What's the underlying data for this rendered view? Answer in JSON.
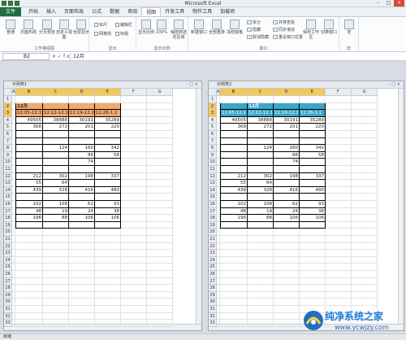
{
  "app": {
    "title": "Microsoft Excel"
  },
  "ribbon_tabs": [
    "文件",
    "开始",
    "插入",
    "页面布局",
    "公式",
    "数据",
    "审阅",
    "视图",
    "开发工具",
    "制作工具",
    "加载项"
  ],
  "active_tab": "视图",
  "ribbon": {
    "groups": [
      "工作簿视图",
      "显示",
      "显示比例",
      "窗口",
      "宏"
    ],
    "view_buttons": [
      "普通",
      "页面布局",
      "分页预览",
      "自定义视图",
      "全屏显示"
    ],
    "show_checks": [
      "标尺",
      "编辑栏",
      "网格线",
      "标题"
    ],
    "zoom_buttons": [
      "显示比例",
      "100%",
      "缩放到选定区域"
    ],
    "window_buttons": [
      "新建窗口",
      "全部重排",
      "冻结窗格"
    ],
    "window_small": [
      "拆分",
      "隐藏",
      "取消隐藏",
      "并排查看",
      "同步滚动",
      "重设窗口位置"
    ],
    "window_more": [
      "保存工作区",
      "切换窗口"
    ],
    "macro_button": "宏"
  },
  "formula_bar": {
    "name_box": "B2",
    "value": "12月"
  },
  "window1": {
    "title": "示例表1"
  },
  "window2": {
    "title": "示例表2"
  },
  "status": "就绪",
  "sheet": {
    "title": "12月",
    "dates": [
      "12.05-12.11",
      "12.12-12.18",
      "12.19-12.25",
      "12.26-1.1"
    ],
    "rows": [
      {
        "r": 4,
        "v": [
          "49505",
          "38888",
          "30191",
          "35289"
        ]
      },
      {
        "r": 5,
        "v": [
          "368",
          "272",
          "201",
          "220"
        ]
      },
      {
        "r": 8,
        "v": [
          "",
          "124",
          "160",
          "342"
        ]
      },
      {
        "r": 9,
        "v": [
          "",
          "",
          "86",
          "58"
        ]
      },
      {
        "r": 10,
        "v": [
          "",
          "",
          "74",
          ""
        ]
      },
      {
        "r": 12,
        "v": [
          "212",
          "302",
          "198",
          "337"
        ]
      },
      {
        "r": 13,
        "v": [
          "55",
          "64",
          "",
          ""
        ]
      },
      {
        "r": 14,
        "v": [
          "439",
          "328",
          "416",
          "480"
        ]
      },
      {
        "r": 16,
        "v": [
          "102",
          "108",
          "62",
          "93"
        ]
      },
      {
        "r": 17,
        "v": [
          "48",
          "19",
          "24",
          "38"
        ]
      },
      {
        "r": 18,
        "v": [
          "196",
          "88",
          "106",
          "106"
        ]
      }
    ]
  },
  "watermark": {
    "text": "纯净系统之家",
    "url": "www.ycwjzy.com"
  }
}
